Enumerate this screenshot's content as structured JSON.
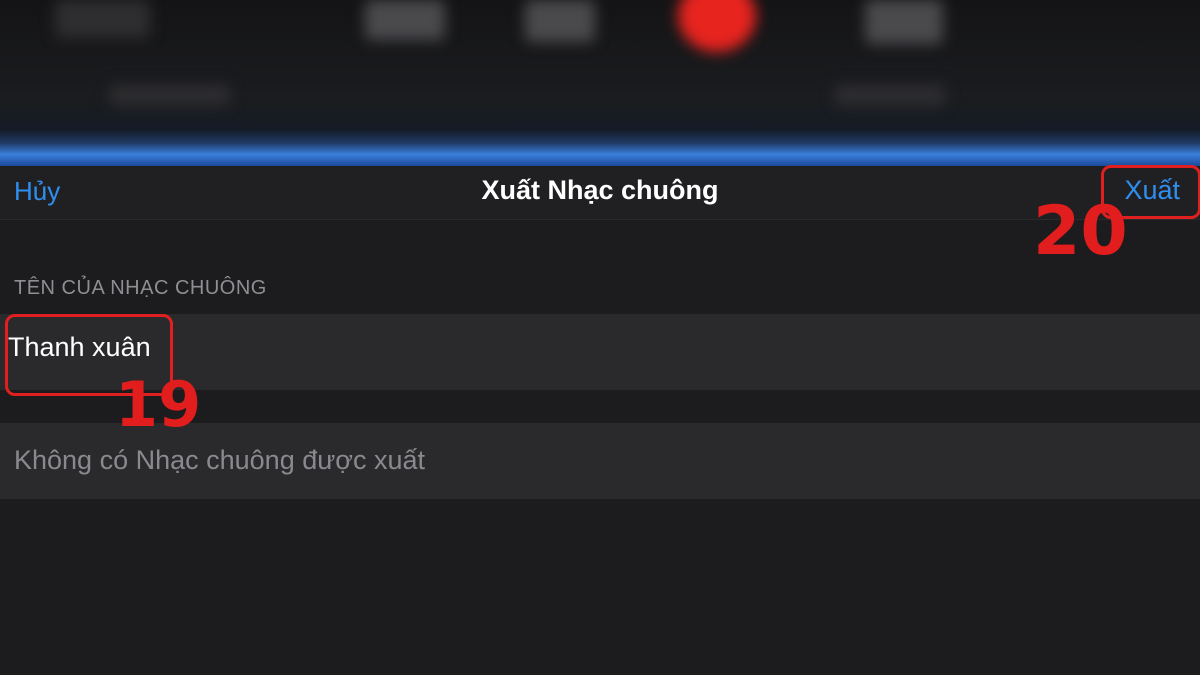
{
  "navbar": {
    "cancel_label": "Hủy",
    "title": "Xuất Nhạc chuông",
    "export_label": "Xuất"
  },
  "section": {
    "header": "TÊN CỦA NHẠC CHUÔNG"
  },
  "ringtone_name": {
    "value": "Thanh xuân"
  },
  "empty_state": {
    "text": "Không có Nhạc chuông được xuất"
  },
  "annotations": {
    "step_name": "19",
    "step_export": "20"
  },
  "colors": {
    "accent": "#2f8ff0",
    "annotation": "#e11d1d",
    "background": "#1c1c1e"
  }
}
